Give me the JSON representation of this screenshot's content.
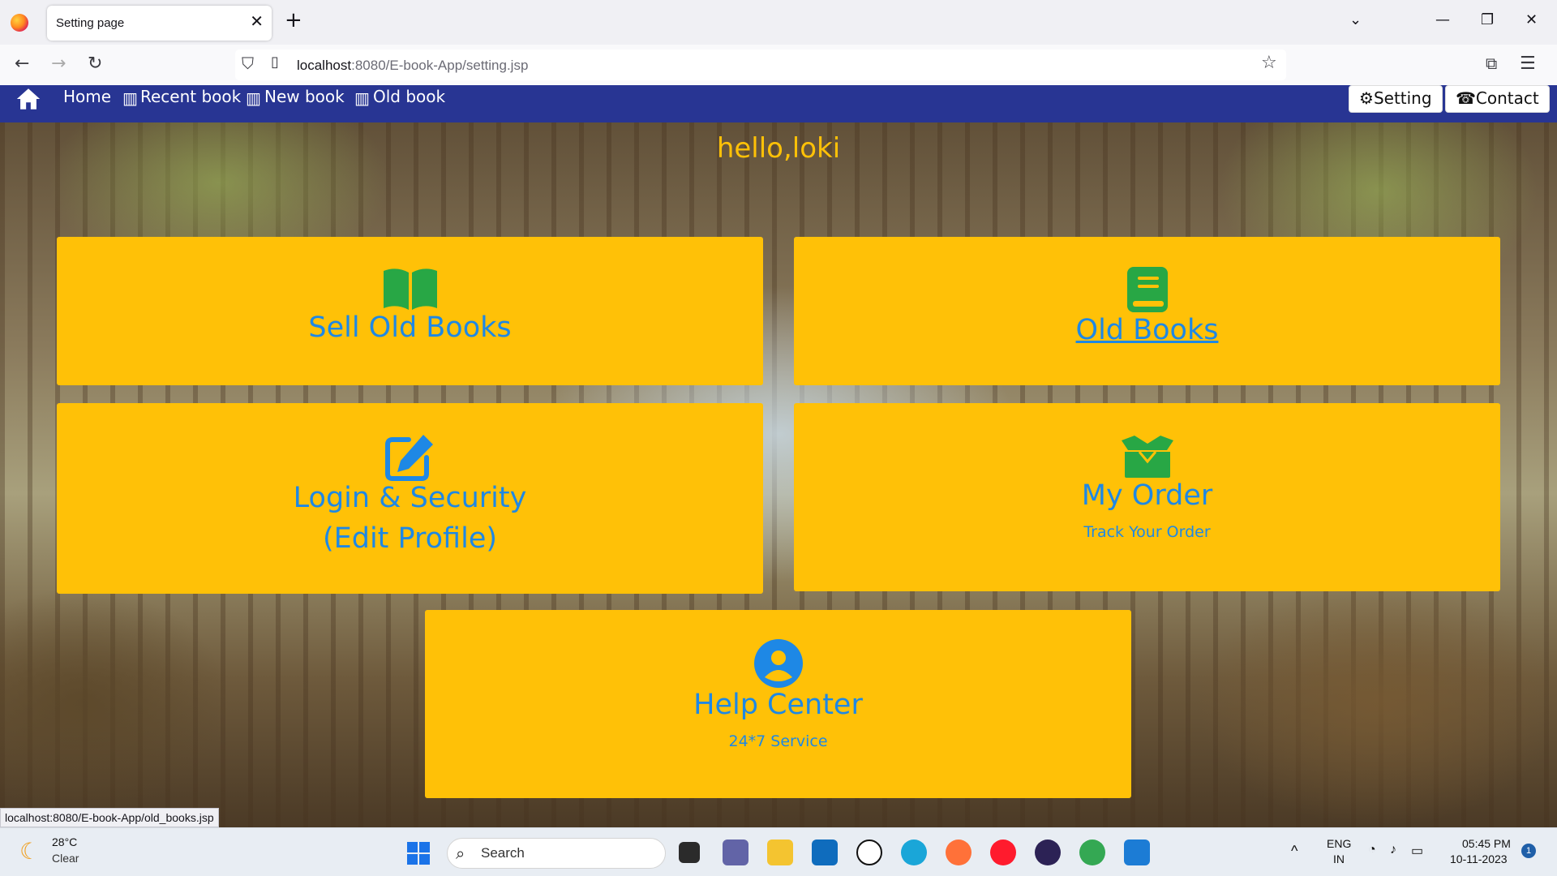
{
  "browser": {
    "tab_title": "Setting page",
    "url_host": "localhost",
    "url_rest": ":8080/E-book-App/setting.jsp",
    "status_url": "localhost:8080/E-book-App/old_books.jsp"
  },
  "nav": {
    "links": [
      "Home",
      "Recent book",
      "New book",
      "Old book"
    ],
    "setting_label": "Setting",
    "contact_label": "Contact",
    "brand_color": "#283593"
  },
  "greeting": "hello,loki",
  "cards": {
    "sell_old_books": {
      "title": "Sell Old Books",
      "icon": "open-book-icon"
    },
    "old_books": {
      "title": "Old Books",
      "icon": "book-icon"
    },
    "login_security": {
      "title": "Login & Security",
      "subtitle": "(Edit Profile)",
      "icon": "edit-icon"
    },
    "my_order": {
      "title": "My Order",
      "subtitle": "Track Your Order",
      "icon": "box-icon"
    },
    "help_center": {
      "title": "Help Center",
      "subtitle": "24*7 Service",
      "icon": "user-circle-icon"
    }
  },
  "colors": {
    "card_bg": "#ffc107",
    "card_text": "#1e88e5",
    "icon_green": "#28a745"
  },
  "taskbar": {
    "temp": "28°C",
    "condition": "Clear",
    "search_label": "Search",
    "lang_line1": "ENG",
    "lang_line2": "IN",
    "time": "05:45 PM",
    "date": "10-11-2023",
    "notif_count": "1"
  }
}
